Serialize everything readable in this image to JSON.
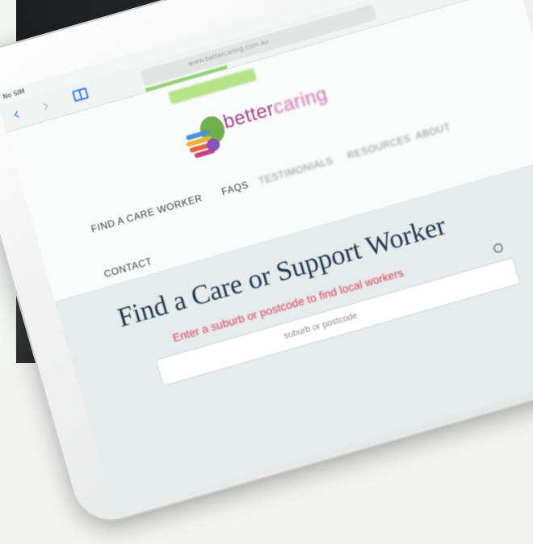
{
  "statusbar": {
    "carrier": "No SIM"
  },
  "browser": {
    "back_icon": "‹",
    "forward_icon": "›",
    "bookmarks_icon": "book-icon",
    "address_text": "www.bettercaring.com.au",
    "load_progress": 0.35
  },
  "site": {
    "brand_part1": "better",
    "brand_part2": "caring",
    "nav": {
      "find": "FIND A CARE WORKER",
      "faqs": "FAQS",
      "testimonials": "TESTIMONIALS",
      "resources": "RESOURCES",
      "about": "ABOUT",
      "contact": "CONTACT"
    },
    "hero": {
      "title": "Find a Care or Support Worker",
      "subtitle": "Enter a suburb or postcode to find local workers",
      "search_placeholder": "suburb or postcode"
    }
  },
  "colors": {
    "brand": "#a8418c",
    "accent_red": "#d9425b",
    "title": "#1e3950",
    "ios_blue": "#2d7cf6"
  }
}
